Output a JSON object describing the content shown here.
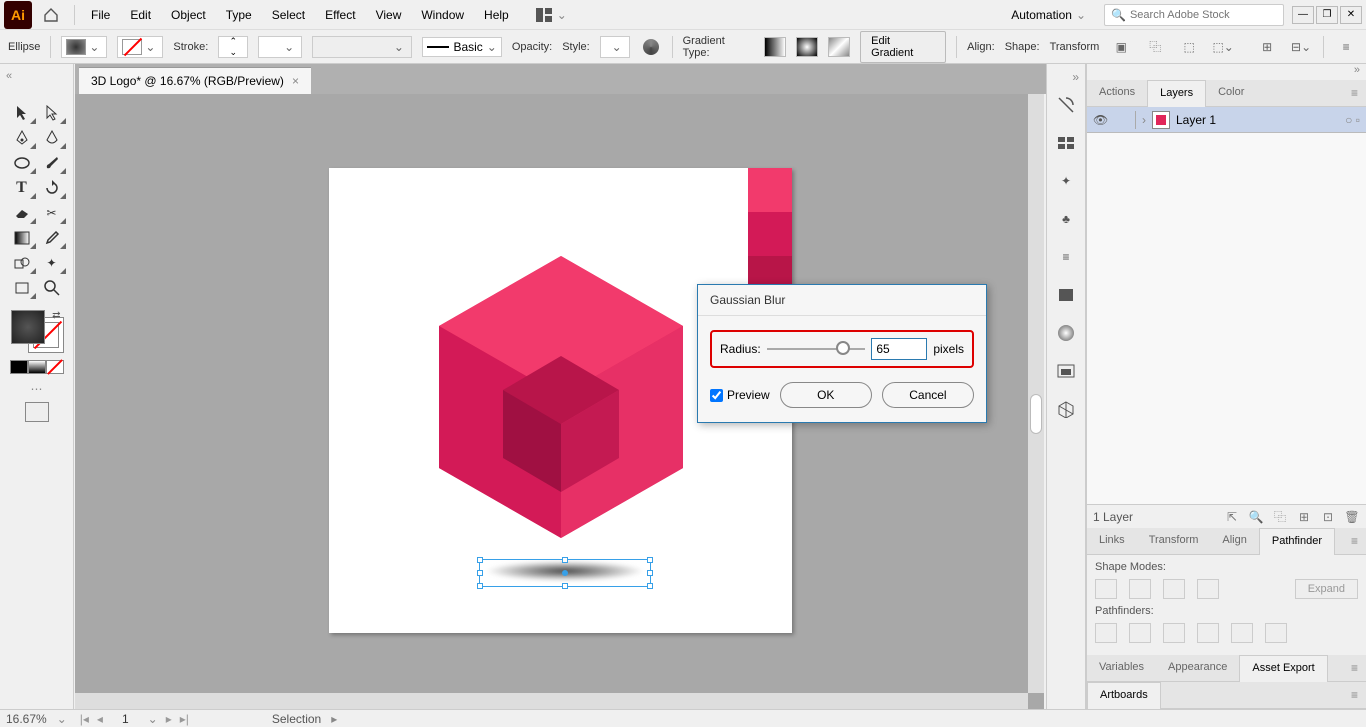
{
  "menu": [
    "File",
    "Edit",
    "Object",
    "Type",
    "Select",
    "Effect",
    "View",
    "Window",
    "Help"
  ],
  "workspace": "Automation",
  "search_placeholder": "Search Adobe Stock",
  "control": {
    "shape": "Ellipse",
    "stroke_label": "Stroke:",
    "profile": "Basic",
    "opacity_label": "Opacity:",
    "style_label": "Style:",
    "gradient_label": "Gradient Type:",
    "edit_gradient": "Edit Gradient",
    "align_label": "Align:",
    "shapes_label": "Shape:",
    "transform_label": "Transform"
  },
  "doc_tab": "3D Logo* @ 16.67% (RGB/Preview)",
  "dialog": {
    "title": "Gaussian Blur",
    "radius_label": "Radius:",
    "radius_value": "65",
    "unit": "pixels",
    "preview": "Preview",
    "ok": "OK",
    "cancel": "Cancel"
  },
  "panels": {
    "top_tabs": [
      "Actions",
      "Layers",
      "Color"
    ],
    "layer_name": "Layer 1",
    "layer_count": "1 Layer",
    "mid_tabs": [
      "Links",
      "Transform",
      "Align",
      "Pathfinder"
    ],
    "shape_modes": "Shape Modes:",
    "expand": "Expand",
    "pathfinders": "Pathfinders:",
    "bottom_tabs": [
      "Variables",
      "Appearance",
      "Asset Export"
    ],
    "bottom_tabs2": [
      "Artboards"
    ]
  },
  "status": {
    "zoom": "16.67%",
    "artboard": "1",
    "mode": "Selection"
  }
}
